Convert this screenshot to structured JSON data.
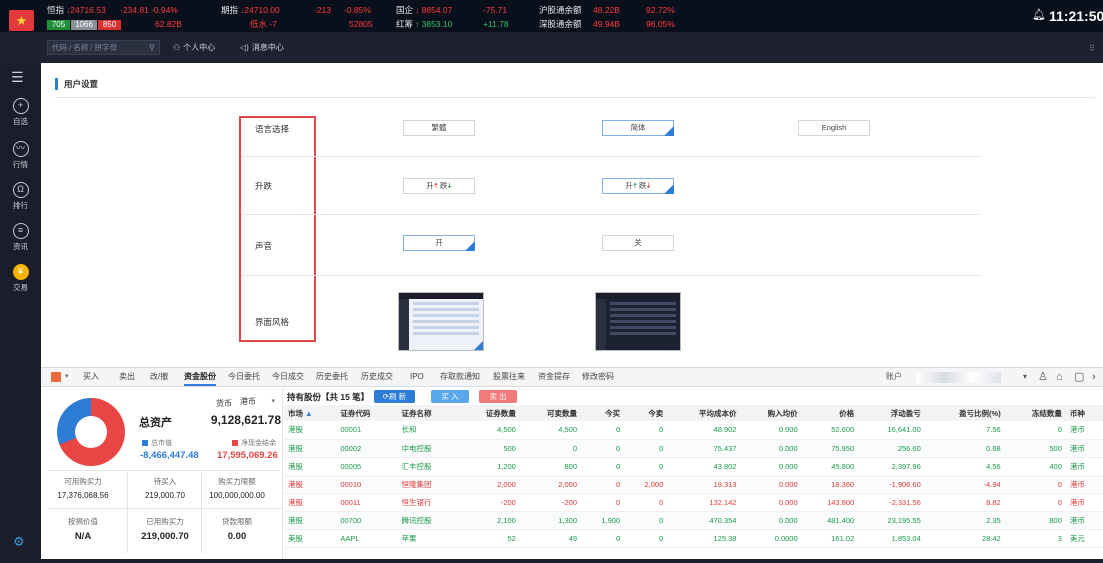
{
  "ticker": {
    "hsi": {
      "label": "恒指",
      "value": "24716.53",
      "change": "-234.81",
      "pct": "-0.94%",
      "up": "705",
      "flat": "1066",
      "down": "850",
      "volume": "62.82B"
    },
    "fut": {
      "label": "期指",
      "value": "24710.00",
      "change": "-213",
      "pct": "-0.85%",
      "vol": "52805",
      "spread": "低水 -7"
    },
    "hscei": {
      "label": "国企",
      "value": "8854.07",
      "change": "-75.71"
    },
    "redchip": {
      "label": "红筹",
      "value": "3853.10",
      "change": "+11.78"
    },
    "sh_conn": {
      "label": "沪股通余额",
      "value": "48.22B",
      "pct": "92.72%"
    },
    "sz_conn": {
      "label": "深股通余额",
      "value": "49.94B",
      "pct": "96.05%"
    },
    "time": "11:21:50"
  },
  "subbar": {
    "search_placeholder": "代码 / 名称 / 拼字母",
    "tabs": [
      {
        "label": "个人中心",
        "icon": "user-icon"
      },
      {
        "label": "消息中心",
        "icon": "speaker-icon"
      }
    ]
  },
  "sidebar": {
    "items": [
      {
        "label": "自选",
        "icon": "plus-circle-icon",
        "glyph": "+"
      },
      {
        "label": "行情",
        "icon": "trend-icon",
        "glyph": "〰"
      },
      {
        "label": "排行",
        "icon": "rank-icon",
        "glyph": "Ω"
      },
      {
        "label": "资讯",
        "icon": "news-icon",
        "glyph": "≡"
      },
      {
        "label": "交易",
        "icon": "trade-icon",
        "glyph": "¥"
      }
    ]
  },
  "settings": {
    "title": "用户设置",
    "rows": {
      "language": {
        "label": "语言选择",
        "options": [
          "繁體",
          "简体",
          "English"
        ],
        "selected": "简体"
      },
      "updown": {
        "label": "升跌",
        "rise": "升",
        "fall": "跌"
      },
      "sound": {
        "label": "声音",
        "options": [
          "开",
          "关"
        ],
        "selected": "开"
      },
      "theme": {
        "label": "界面风格",
        "options": [
          "light",
          "dark"
        ],
        "selected": "light"
      }
    }
  },
  "trade": {
    "tabs": [
      "买入",
      "卖出",
      "改/撤",
      "资金股份",
      "今日委托",
      "今日成交",
      "历史委托",
      "历史成交",
      "IPO",
      "存取款通知",
      "股票往来",
      "资金提存",
      "修改密码"
    ],
    "active_tab": "资金股份",
    "account_label": "账户",
    "currency_label": "货币",
    "currency_value": "港币",
    "total_assets_label": "总资产",
    "total_assets": "9,128,621.78",
    "market_value_label": "总市值",
    "market_value": "-8,466,447.48",
    "net_cash_label": "净现金结余",
    "net_cash": "17,595,069.26",
    "stats": [
      {
        "label": "可用购买力",
        "value": "17,376,068.56"
      },
      {
        "label": "待买入",
        "value": "219,000.70"
      },
      {
        "label": "购买力限额",
        "value": "100,000,000.00"
      },
      {
        "label": "按揭价值",
        "value": "N/A"
      },
      {
        "label": "已用购买力",
        "value": "219,000.70"
      },
      {
        "label": "贷款限额",
        "value": "0.00"
      }
    ],
    "holdings_title": "持有股份【共 15 笔】",
    "refresh_label": "刷 新",
    "buy_label": "买 入",
    "sell_label": "卖 出",
    "columns": [
      "市场",
      "证券代码",
      "证券名称",
      "证券数量",
      "可卖数量",
      "今买",
      "今卖",
      "平均成本价",
      "购入均价",
      "价格",
      "浮动盈亏",
      "盈亏比例(%)",
      "冻结数量",
      "币种"
    ],
    "rows": [
      {
        "market": "港股",
        "code": "00001",
        "name": "长和",
        "qty": "4,500",
        "sellable": "4,500",
        "buy": "0",
        "sell": "0",
        "avg": "48.902",
        "bavg": "0.000",
        "price": "52.600",
        "pnl": "16,641.00",
        "pct": "7.56",
        "frozen": "0",
        "cur": "港币",
        "neg": false
      },
      {
        "market": "港股",
        "code": "00002",
        "name": "中电控股",
        "qty": "500",
        "sellable": "0",
        "buy": "0",
        "sell": "0",
        "avg": "75.437",
        "bavg": "0.000",
        "price": "75.950",
        "pnl": "256.60",
        "pct": "0.68",
        "frozen": "500",
        "cur": "港币",
        "neg": false
      },
      {
        "market": "港股",
        "code": "00005",
        "name": "汇丰控股",
        "qty": "1,200",
        "sellable": "800",
        "buy": "0",
        "sell": "0",
        "avg": "43.802",
        "bavg": "0.000",
        "price": "45.800",
        "pnl": "2,397.96",
        "pct": "4.56",
        "frozen": "400",
        "cur": "港币",
        "neg": false
      },
      {
        "market": "港股",
        "code": "00010",
        "name": "恒隆集团",
        "qty": "2,000",
        "sellable": "2,000",
        "buy": "0",
        "sell": "2,000",
        "avg": "19.313",
        "bavg": "0.000",
        "price": "18.360",
        "pnl": "-1,906.60",
        "pct": "-4.94",
        "frozen": "0",
        "cur": "港币",
        "neg": true
      },
      {
        "market": "港股",
        "code": "00011",
        "name": "恒生银行",
        "qty": "-200",
        "sellable": "-200",
        "buy": "0",
        "sell": "0",
        "avg": "132.142",
        "bavg": "0.000",
        "price": "143.800",
        "pnl": "-2,331.56",
        "pct": "8.82",
        "frozen": "0",
        "cur": "港币",
        "neg": true
      },
      {
        "market": "港股",
        "code": "00700",
        "name": "腾讯控股",
        "qty": "2,100",
        "sellable": "1,300",
        "buy": "1,900",
        "sell": "0",
        "avg": "470.354",
        "bavg": "0.000",
        "price": "481.400",
        "pnl": "23,195.55",
        "pct": "2.35",
        "frozen": "800",
        "cur": "港币",
        "neg": false
      },
      {
        "market": "美股",
        "code": "AAPL",
        "name": "苹果",
        "qty": "52",
        "sellable": "49",
        "buy": "0",
        "sell": "0",
        "avg": "125.38",
        "bavg": "0.0000",
        "price": "161.02",
        "pnl": "1,853.04",
        "pct": "28.42",
        "frozen": "3",
        "cur": "美元",
        "neg": false
      }
    ]
  }
}
